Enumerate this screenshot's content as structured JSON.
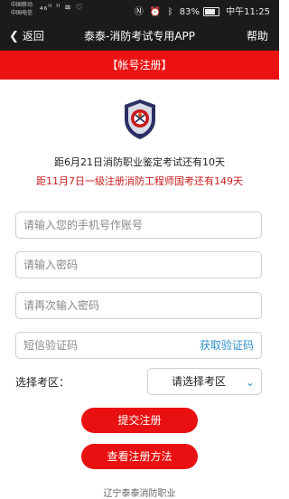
{
  "status": {
    "carrier_1": "中国移动",
    "carrier_2": "中国电信",
    "left_icons": "₄₆ᴵˡ ᴵˡ ≋ ♡",
    "battery": "83%",
    "time": "中午11:25"
  },
  "appbar": {
    "back_label": "返回",
    "title": "泰泰-消防考试专用APP",
    "help_label": "帮助"
  },
  "section_title": "【帐号注册】",
  "notices": {
    "line1": "距6月21日消防职业鉴定考试还有10天",
    "line2": "距11月7日一级注册消防工程师国考还有149天"
  },
  "form": {
    "phone_placeholder": "请输入您的手机号作账号",
    "password_placeholder": "请输入密码",
    "password2_placeholder": "请再次输入密码",
    "sms_placeholder": "短信验证码",
    "sms_button": "获取验证码",
    "region_label": "选择考区：",
    "region_value": "请选择考区"
  },
  "buttons": {
    "submit": "提交注册",
    "howto": "查看注册方法"
  },
  "footer": "辽宁泰泰消防职业",
  "colors": {
    "accent_red": "#ec1212",
    "link_blue": "#2f8fcc",
    "bar_dark": "#1b1b1b"
  }
}
